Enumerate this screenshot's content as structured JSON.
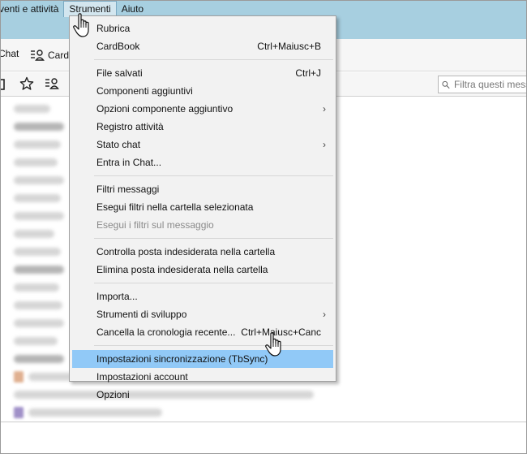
{
  "menubar": {
    "items": [
      {
        "label": "venti e attività"
      },
      {
        "label": "Strumenti",
        "underline": "S"
      },
      {
        "label": "Aiuto",
        "underline": "u"
      }
    ]
  },
  "toolbar1": {
    "chat_label": "Chat",
    "cardbook_label": "Card"
  },
  "search": {
    "placeholder": "Filtra questi mess"
  },
  "menu": {
    "groups": [
      [
        {
          "label": "Rubrica",
          "shortcut": ""
        },
        {
          "label": "CardBook",
          "shortcut": "Ctrl+Maiusc+B"
        }
      ],
      [
        {
          "label": "File salvati",
          "shortcut": "Ctrl+J"
        },
        {
          "label": "Componenti aggiuntivi",
          "shortcut": ""
        },
        {
          "label": "Opzioni componente aggiuntivo",
          "shortcut": "",
          "submenu": true
        },
        {
          "label": "Registro attività",
          "shortcut": ""
        },
        {
          "label": "Stato chat",
          "shortcut": "",
          "submenu": true
        },
        {
          "label": "Entra in Chat...",
          "shortcut": ""
        }
      ],
      [
        {
          "label": "Filtri messaggi",
          "shortcut": ""
        },
        {
          "label": "Esegui filtri nella cartella selezionata",
          "shortcut": ""
        },
        {
          "label": "Esegui i filtri sul messaggio",
          "shortcut": "",
          "disabled": true
        }
      ],
      [
        {
          "label": "Controlla posta indesiderata nella cartella",
          "shortcut": ""
        },
        {
          "label": "Elimina posta indesiderata nella cartella",
          "shortcut": ""
        }
      ],
      [
        {
          "label": "Importa...",
          "shortcut": ""
        },
        {
          "label": "Strumenti di sviluppo",
          "shortcut": "",
          "submenu": true
        },
        {
          "label": "Cancella la cronologia recente...",
          "shortcut": "Ctrl+Maiusc+Canc"
        }
      ],
      [
        {
          "label": "Impostazioni sincronizzazione (TbSync)",
          "shortcut": "",
          "highlighted": true
        },
        {
          "label": "Impostazioni account",
          "shortcut": ""
        },
        {
          "label": "Opzioni",
          "shortcut": ""
        }
      ]
    ]
  },
  "list": {
    "rows": [
      {
        "width": 45,
        "bold": false
      },
      {
        "width": 62,
        "bold": true
      },
      {
        "width": 58,
        "bold": false
      },
      {
        "width": 54,
        "bold": false
      },
      {
        "width": 62,
        "bold": false
      },
      {
        "width": 58,
        "bold": false
      },
      {
        "width": 62,
        "bold": false
      },
      {
        "width": 50,
        "bold": false
      },
      {
        "width": 58,
        "bold": false
      },
      {
        "width": 62,
        "bold": true
      },
      {
        "width": 56,
        "bold": false
      },
      {
        "width": 60,
        "bold": false
      },
      {
        "width": 62,
        "bold": false
      },
      {
        "width": 54,
        "bold": false
      },
      {
        "width": 62,
        "bold": true
      },
      {
        "width": 60,
        "bold": false,
        "thumb": "#e0b090"
      },
      {
        "width": 370,
        "bold": false
      },
      {
        "width": 165,
        "bold": false,
        "thumb": "#a090c8"
      }
    ]
  },
  "icons": {
    "star": "star-icon",
    "address_book": "address-book-icon",
    "search": "search-icon",
    "hand": "hand-cursor-icon"
  }
}
